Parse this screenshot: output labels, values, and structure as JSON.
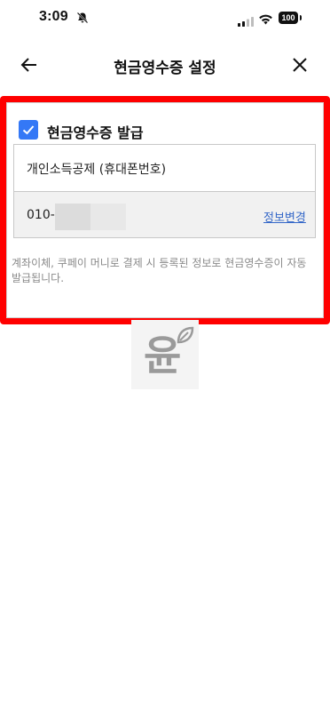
{
  "status_bar": {
    "time": "3:09",
    "battery": "100"
  },
  "header": {
    "title": "현금영수증 설정"
  },
  "receipt": {
    "checkbox_label": "현금영수증 발급",
    "checked": true,
    "type_label": "개인소득공제 (휴대폰번호)",
    "phone_prefix": "010-",
    "change_link": "정보변경",
    "notice": "계좌이체, 쿠페이 머니로 결제 시 등록된 정보로 현금영수증이 자동 발급됩니다."
  },
  "watermark": {
    "char": "윤"
  },
  "colors": {
    "accent": "#3478f6",
    "highlight": "#ff0000",
    "link": "#3467c8"
  }
}
